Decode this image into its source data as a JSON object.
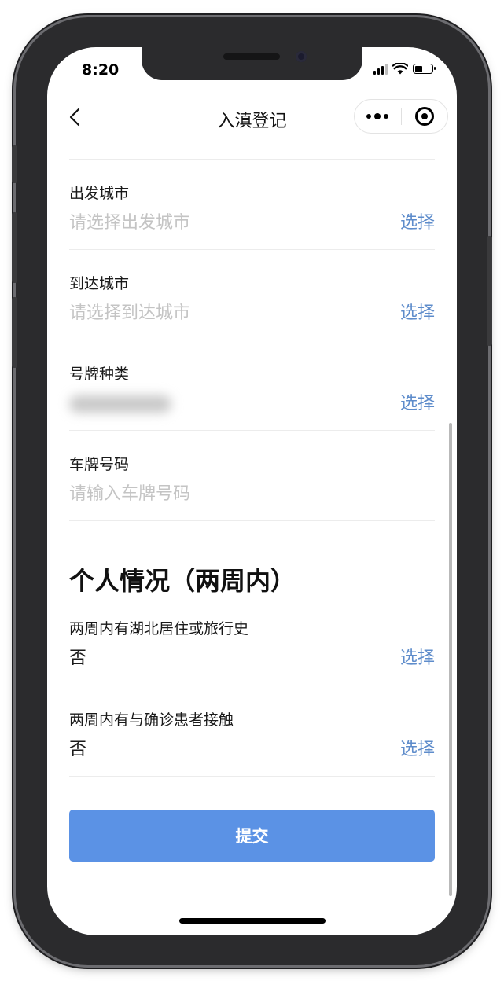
{
  "status_bar": {
    "time": "8:20"
  },
  "nav": {
    "title": "入滇登记"
  },
  "fields": [
    {
      "label": "出发城市",
      "placeholder": "请选择出发城市",
      "action": "选择"
    },
    {
      "label": "到达城市",
      "placeholder": "请选择到达城市",
      "action": "选择"
    },
    {
      "label": "号牌种类",
      "value": "",
      "action": "选择"
    },
    {
      "label": "车牌号码",
      "placeholder": "请输入车牌号码"
    }
  ],
  "personal": {
    "title": "个人情况（两周内）",
    "questions": [
      {
        "label": "两周内有湖北居住或旅行史",
        "value": "否",
        "action": "选择"
      },
      {
        "label": "两周内有与确诊患者接触",
        "value": "否",
        "action": "选择"
      }
    ]
  },
  "submit_label": "提交",
  "colors": {
    "accent": "#5e8ccb",
    "button": "#5b92e5",
    "placeholder": "#c4c4c4"
  }
}
